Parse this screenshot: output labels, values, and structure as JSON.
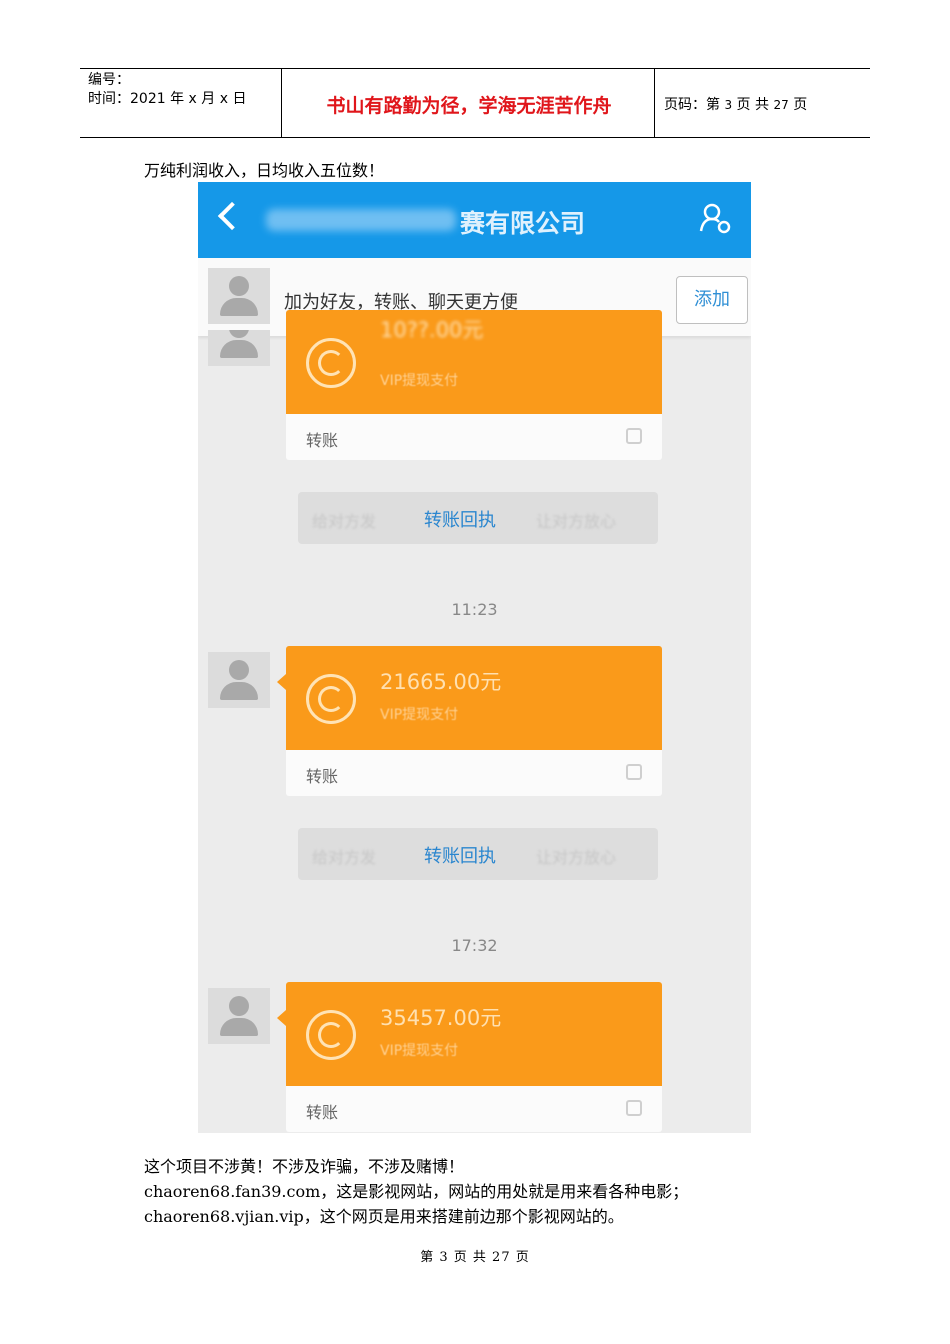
{
  "header": {
    "number_label": "编号：",
    "date_label": "时间：2021 年 x 月 x 日",
    "motto": "书山有路勤为径，学海无涯苦作舟",
    "page_prefix": "页码：第",
    "page_current": "3",
    "page_mid": "页  共",
    "page_total": "27",
    "page_suffix": "页"
  },
  "body": {
    "intro": "万纯利润收入，日均收入五位数！",
    "line1": "这个项目不涉黄！不涉及诈骗，不涉及赌博！",
    "line2": "chaoren68.fan39.com，这是影视网站，网站的用处就是用来看各种电影；",
    "line3": "chaoren68.vjian.vip，这个网页是用来搭建前边那个影视网站的。"
  },
  "footer": "第 3 页 共 27 页",
  "screenshot": {
    "title": "赛有限公司",
    "add_bar_text": "加为好友，转账、聊天更方便",
    "add_button": "添加",
    "messages": [
      {
        "amount": "10??.00元",
        "subtitle": "VIP提现支付",
        "label": "转账"
      },
      {
        "amount": "21665.00元",
        "subtitle": "VIP提现支付",
        "label": "转账"
      },
      {
        "amount": "35457.00元",
        "subtitle": "VIP提现支付",
        "label": "转账"
      }
    ],
    "receipt": {
      "left": "给对方发",
      "link": "转账回执",
      "right": "让对方放心"
    },
    "times": [
      "11:23",
      "17:32"
    ]
  }
}
